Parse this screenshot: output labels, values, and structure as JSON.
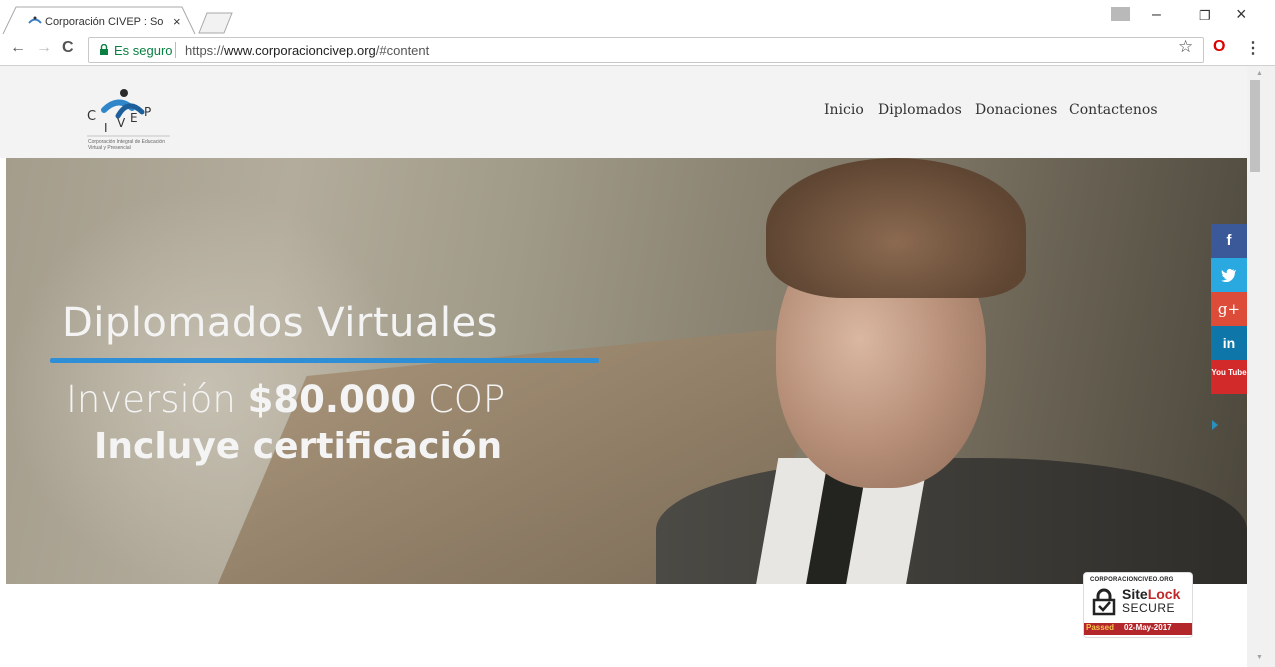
{
  "browser": {
    "tab_title": "Corporación CIVEP : Som",
    "tab_close": "×",
    "address": {
      "secure_label": "Es seguro",
      "url_scheme": "https://",
      "url_host": "www.corporacioncivep.org",
      "url_path": "/#content"
    },
    "icons": {
      "back": "←",
      "forward": "→",
      "reload": "C",
      "star": "☆",
      "opera": "O",
      "menu": "⋮",
      "minimize": "–",
      "restore": "❐",
      "close": "×"
    }
  },
  "site": {
    "logo": {
      "letters": [
        "C",
        "I",
        "V",
        "E",
        "P"
      ],
      "subtitle": "Corporación Integral de Educación Virtual y Presencial"
    },
    "nav": [
      "Inicio",
      "Diplomados",
      "Donaciones",
      "Contactenos"
    ],
    "hero": {
      "title": "Diplomados Virtuales",
      "investment_prefix": "Inversión",
      "investment_amount": "$80.000",
      "investment_currency": "COP",
      "certification": "Incluye certificación"
    },
    "social": [
      {
        "name": "facebook",
        "label": "f",
        "color": "#3b5998"
      },
      {
        "name": "twitter",
        "label": "🐦",
        "color": "#2aa9e0"
      },
      {
        "name": "google-plus",
        "label": "g+",
        "color": "#dd4b39"
      },
      {
        "name": "linkedin",
        "label": "in",
        "color": "#0e76a8"
      },
      {
        "name": "youtube",
        "label": "You Tube",
        "color": "#d22a2a"
      }
    ],
    "sitelock": {
      "domain": "CORPORACIONCIVEO.ORG",
      "brand_a": "Site",
      "brand_b": "Lock",
      "secure": "SECURE",
      "passed": "Passed",
      "date": "02-May-2017"
    }
  },
  "colors": {
    "accent_rule": "#2f8fd6",
    "secure_green": "#0b8043"
  }
}
